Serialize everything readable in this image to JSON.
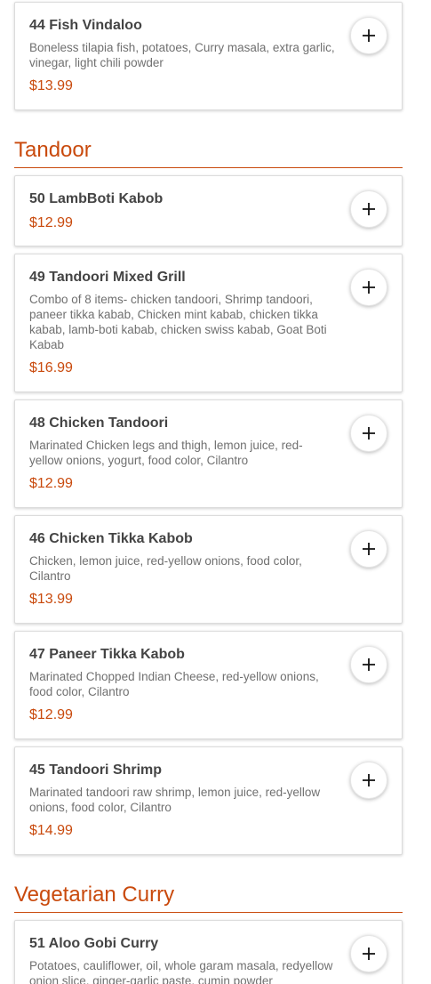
{
  "colors": {
    "accent": "#c94a0d",
    "item_name": "#444444",
    "item_desc": "#707070",
    "card_border": "#dcdcdc"
  },
  "icons": {
    "add": "plus-icon"
  },
  "sections": [
    {
      "title": "",
      "items": [
        {
          "name": "44 Fish Vindaloo",
          "description": "Boneless tilapia fish, potatoes, Curry masala, extra garlic, vinegar, light chili powder",
          "price": "$13.99"
        }
      ]
    },
    {
      "title": "Tandoor",
      "items": [
        {
          "name": "50 LambBoti Kabob",
          "description": "",
          "price": "$12.99"
        },
        {
          "name": "49 Tandoori Mixed Grill",
          "description": "Combo of 8 items- chicken tandoori, Shrimp tandoori, paneer tikka kabab, Chicken mint kabab, chicken tikka kabab, lamb-boti kabab, chicken swiss kabab, Goat Boti Kabab",
          "price": "$16.99"
        },
        {
          "name": "48 Chicken Tandoori",
          "description": "Marinated Chicken legs and thigh, lemon juice, red-yellow onions, yogurt, food color, Cilantro",
          "price": "$12.99"
        },
        {
          "name": "46 Chicken Tikka Kabob",
          "description": "Chicken, lemon juice, red-yellow onions, food color, Cilantro",
          "price": "$13.99"
        },
        {
          "name": "47 Paneer Tikka Kabob",
          "description": "Marinated Chopped Indian Cheese, red-yellow onions, food color, Cilantro",
          "price": "$12.99"
        },
        {
          "name": "45 Tandoori Shrimp",
          "description": "Marinated tandoori raw shrimp, lemon juice, red-yellow onions, food color, Cilantro",
          "price": "$14.99"
        }
      ]
    },
    {
      "title": "Vegetarian Curry",
      "items": [
        {
          "name": "51 Aloo Gobi Curry",
          "description": "Potatoes, cauliflower, oil, whole garam masala, redyellow onion slice, ginger-garlic paste, cumin powder",
          "price": ""
        }
      ]
    }
  ]
}
